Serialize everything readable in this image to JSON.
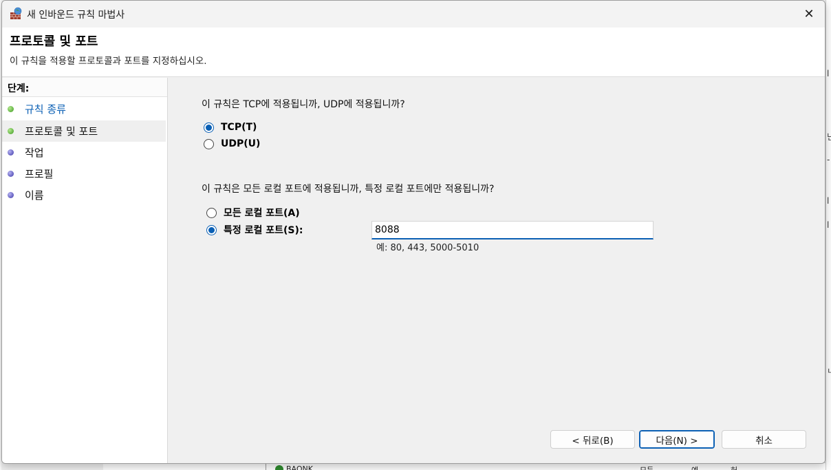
{
  "dialog": {
    "title": "새 인바운드 규칙 마법사",
    "close_glyph": "✕"
  },
  "header": {
    "title": "프로토콜 및 포트",
    "subtitle": "이 규칙을 적용할 프로토콜과 포트를 지정하십시오."
  },
  "steps": {
    "heading": "단계:",
    "items": [
      {
        "label": "규칙 종류",
        "status": "done",
        "dot_color": "#3c9a1f"
      },
      {
        "label": "프로토콜 및 포트",
        "status": "current",
        "dot_color": "#3c9a1f"
      },
      {
        "label": "작업",
        "status": "pending",
        "dot_color": "#3b35a8"
      },
      {
        "label": "프로필",
        "status": "pending",
        "dot_color": "#3b35a8"
      },
      {
        "label": "이름",
        "status": "pending",
        "dot_color": "#3b35a8"
      }
    ]
  },
  "protocol": {
    "question": "이 규칙은 TCP에 적용됩니까, UDP에 적용됩니까?",
    "options": [
      {
        "label": "TCP(T)",
        "selected": true
      },
      {
        "label": "UDP(U)",
        "selected": false
      }
    ]
  },
  "ports": {
    "question": "이 규칙은 모든 로컬 포트에 적용됩니까, 특정 로컬 포트에만 적용됩니까?",
    "options": [
      {
        "label": "모든 로컬 포트(A)",
        "selected": false
      },
      {
        "label": "특정 로컬 포트(S):",
        "selected": true
      }
    ],
    "input_value": "8088",
    "example": "예: 80, 443, 5000-5010"
  },
  "buttons": {
    "back": "< 뒤로(B)",
    "next": "다음(N) >",
    "cancel": "취소"
  },
  "background": {
    "row_text": "BAONK",
    "col2": "모든",
    "col3": "예",
    "col4": "허",
    "right_glyphs": [
      "l",
      "닌",
      "-",
      "l",
      "l",
      "ㄴ"
    ]
  },
  "colors": {
    "accent": "#0a5fb4",
    "done_dot": "#3c9a1f",
    "pending_dot": "#3b35a8"
  }
}
